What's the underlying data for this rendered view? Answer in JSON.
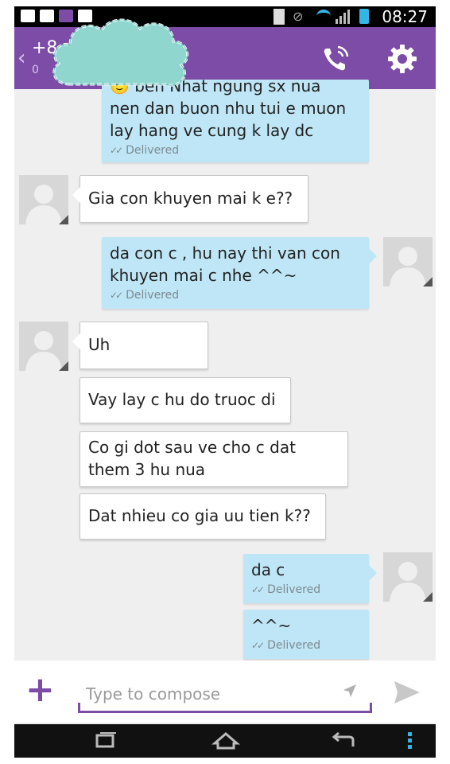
{
  "status_bar": {
    "time": "08:27"
  },
  "header": {
    "contact_number": "+8",
    "contact_sub": "0",
    "call_icon": "phone-call-icon",
    "settings_icon": "gear-icon",
    "back_icon": "chevron-left-icon"
  },
  "messages": [
    {
      "direction": "outgoing",
      "lines": [
        "🙂 ben Nhat ngung sx nua",
        "nen dan buon nhu tui e muon",
        "lay hang ve cung k lay dc"
      ],
      "status": "Delivered"
    },
    {
      "direction": "incoming",
      "text": "Gia con khuyen mai k e??"
    },
    {
      "direction": "outgoing",
      "lines": [
        "da con c , hu nay thi van con",
        "khuyen mai c nhe ^^~"
      ],
      "status": "Delivered"
    },
    {
      "direction": "incoming",
      "text": "Uh"
    },
    {
      "direction": "incoming",
      "text": "Vay lay c hu do truoc di"
    },
    {
      "direction": "incoming",
      "lines": [
        "Co gi dot sau ve cho c dat",
        "them 3 hu nua"
      ]
    },
    {
      "direction": "incoming",
      "text": "Dat nhieu co gia uu tien k??"
    },
    {
      "direction": "outgoing",
      "text": "da c",
      "status": "Delivered"
    },
    {
      "direction": "outgoing",
      "text": "^^~",
      "status": "Delivered"
    }
  ],
  "compose": {
    "placeholder": "Type to compose",
    "add_icon": "plus-icon",
    "location_icon": "location-arrow-icon",
    "send_icon": "send-icon"
  },
  "navbar": {
    "icons": [
      "recent-apps-icon",
      "home-icon",
      "back-icon",
      "menu-icon"
    ]
  },
  "colors": {
    "header": "#7c4ca6",
    "outgoing_bubble": "#bfe6f6",
    "incoming_bubble": "#ffffff",
    "background": "#efefef",
    "accent": "#7c4ca6"
  }
}
